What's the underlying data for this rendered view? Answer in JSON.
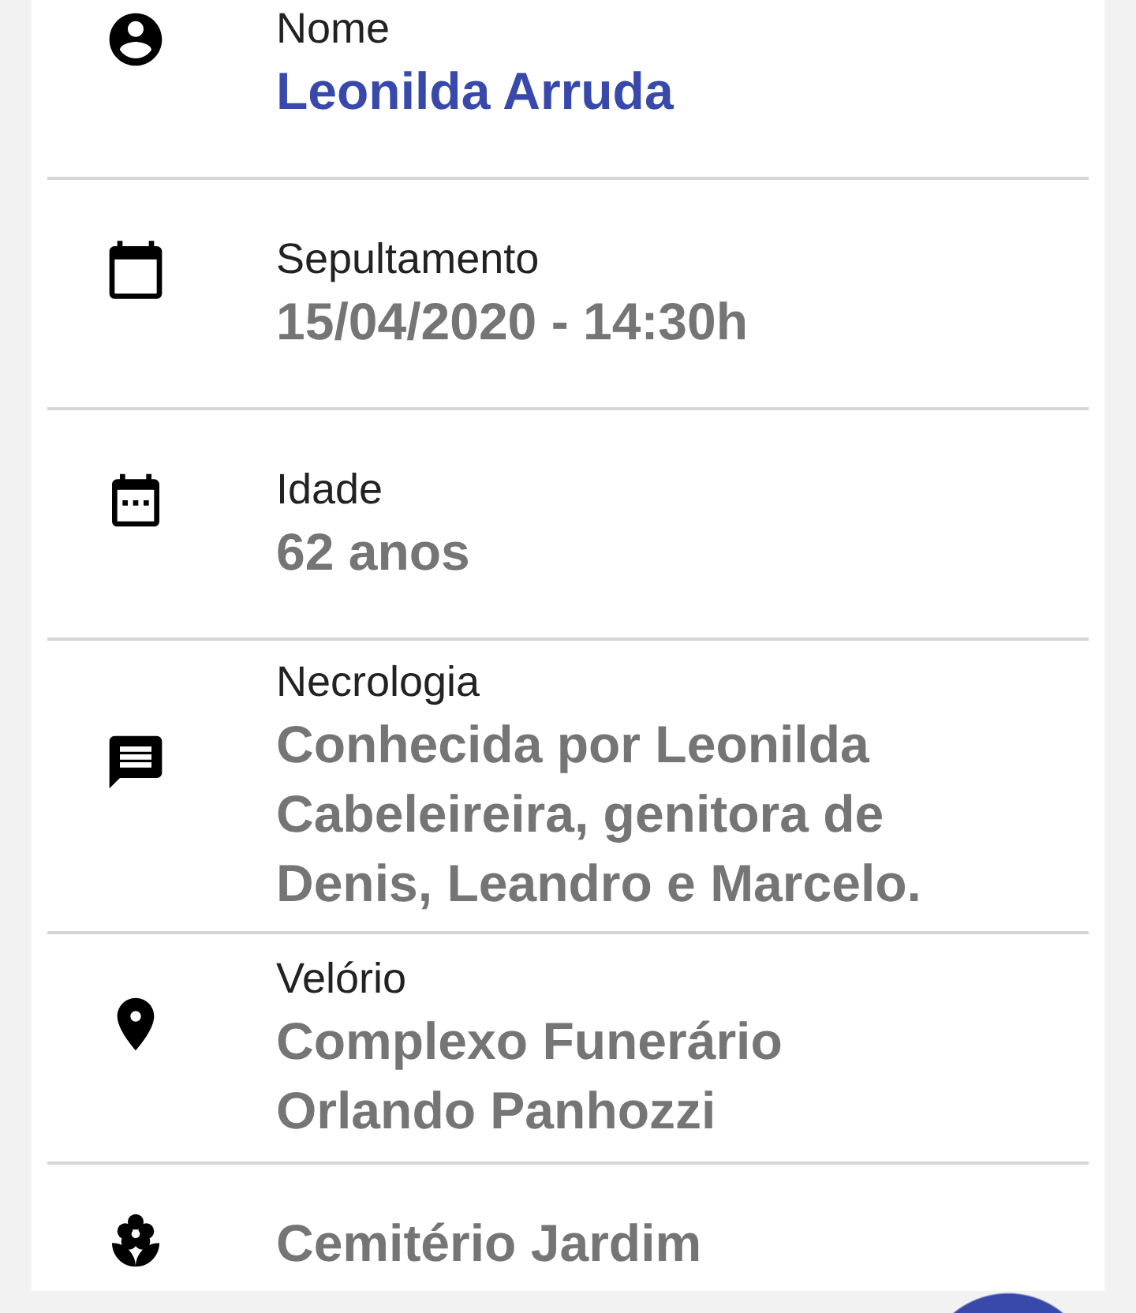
{
  "fields": [
    {
      "kind": "name",
      "label": "Nome",
      "value": "Leonilda Arruda"
    },
    {
      "kind": "detail",
      "label": "Sepultamento",
      "value": "15/04/2020 - 14:30h"
    },
    {
      "kind": "detail",
      "label": "Idade",
      "value": "62 anos"
    },
    {
      "kind": "detail",
      "label": "Necrologia",
      "value": "Conhecida por Leonilda Cabeleireira, genitora de Denis, Leandro e Marcelo."
    },
    {
      "kind": "detail",
      "label": "Velório",
      "value": "Complexo Funerário Orlando Panhozzi"
    },
    {
      "kind": "detail",
      "value": "Cemitério Jardim"
    }
  ]
}
